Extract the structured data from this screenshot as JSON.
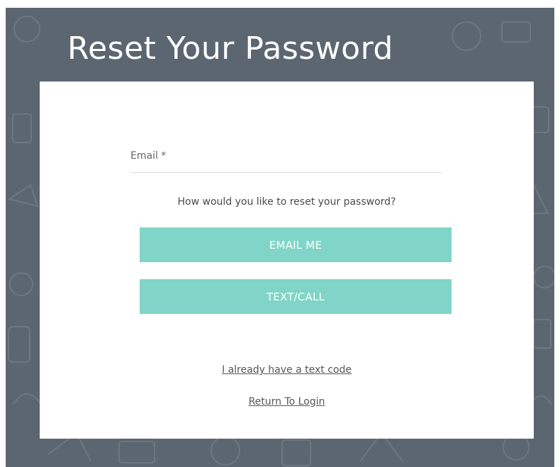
{
  "page": {
    "title": "Reset Your Password"
  },
  "form": {
    "email_label": "Email *",
    "email_value": "",
    "question": "How would you like to reset your password?",
    "email_me_label": "EMAIL ME",
    "text_call_label": "TEXT/CALL",
    "have_code_link": "I already have a text code",
    "return_login_link": "Return To Login"
  },
  "colors": {
    "background": "#5b6670",
    "button": "#80d5c8",
    "card": "#ffffff"
  }
}
